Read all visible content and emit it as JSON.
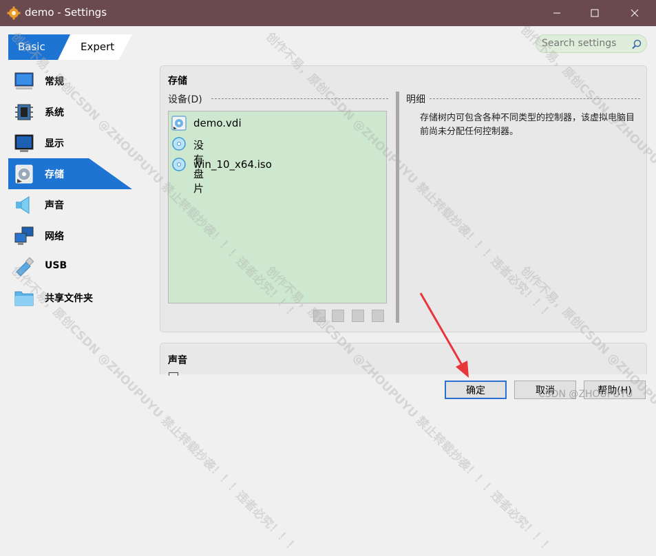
{
  "window": {
    "title": "demo - Settings"
  },
  "mode_tabs": {
    "basic": "Basic",
    "expert": "Expert"
  },
  "search": {
    "placeholder": "Search settings"
  },
  "sidebar": {
    "items": [
      {
        "label": "常规",
        "icon": "general-monitor-icon"
      },
      {
        "label": "系统",
        "icon": "system-chip-icon"
      },
      {
        "label": "显示",
        "icon": "display-monitor-icon"
      },
      {
        "label": "存储",
        "icon": "storage-disk-icon",
        "active": true
      },
      {
        "label": "声音",
        "icon": "speaker-icon"
      },
      {
        "label": "网络",
        "icon": "network-icon"
      },
      {
        "label": "USB",
        "icon": "usb-icon"
      },
      {
        "label": "共享文件夹",
        "icon": "shared-folder-icon"
      }
    ]
  },
  "storage": {
    "title": "存储",
    "devices_label": "设备(D)",
    "details_label": "明细",
    "tree": [
      {
        "label": "demo.vdi",
        "icon": "hard-disk-icon"
      },
      {
        "label": "没有盘片",
        "icon": "optical-disc-icon"
      },
      {
        "label": "win_10_x64.iso",
        "icon": "optical-disc-icon"
      }
    ],
    "details_text": "存储树内可包含各种不同类型的控制器，该虚拟电脑目前尚未分配任何控制器。"
  },
  "audio": {
    "title": "声音"
  },
  "buttons": {
    "ok": "确定",
    "cancel": "取消",
    "help": "帮助(H)"
  },
  "watermark": {
    "text": "创作不易，原创CSDN @ZHOUPUYU 禁止转载抄袭！！！违者必究！！！",
    "credit": "CSDN @ZHOUPUYU"
  },
  "colors": {
    "titlebar": "#6b4a4f",
    "accent": "#1e74d2",
    "tree_bg": "#cde8cf",
    "arrow": "#e8353a"
  }
}
